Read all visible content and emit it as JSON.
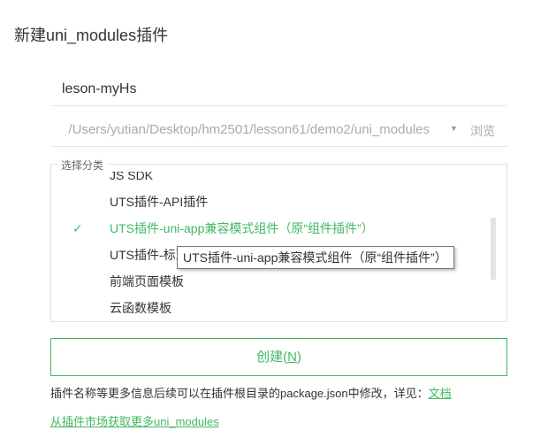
{
  "dialog": {
    "title": "新建uni_modules插件"
  },
  "name_field": {
    "value": "leson-myHs"
  },
  "path_field": {
    "value": "/Users/yutian/Desktop/hm2501/lesson61/demo2/uni_modules",
    "browse_label": "浏览"
  },
  "category": {
    "legend": "选择分类",
    "items": [
      {
        "label": "JS SDK",
        "selected": false
      },
      {
        "label": "UTS插件-API插件",
        "selected": false
      },
      {
        "label": "UTS插件-uni-app兼容模式组件（原“组件插件”）",
        "selected": true
      },
      {
        "label": "UTS插件-标准模式组件",
        "selected": false
      },
      {
        "label": "前端页面模板",
        "selected": false
      },
      {
        "label": "云函数模板",
        "selected": false
      }
    ],
    "tooltip": "UTS插件-uni-app兼容模式组件（原“组件插件”）"
  },
  "create_button": {
    "label": "创建(",
    "mnemonic": "N",
    "label_end": ")"
  },
  "info": {
    "text": "插件名称等更多信息后续可以在插件根目录的package.json中修改，详见：",
    "link": "文档"
  },
  "market_link": "从插件市场获取更多uni_modules",
  "colors": {
    "accent": "#42b863",
    "border": "#e0e0e0",
    "muted_text": "#aaaaaa"
  }
}
